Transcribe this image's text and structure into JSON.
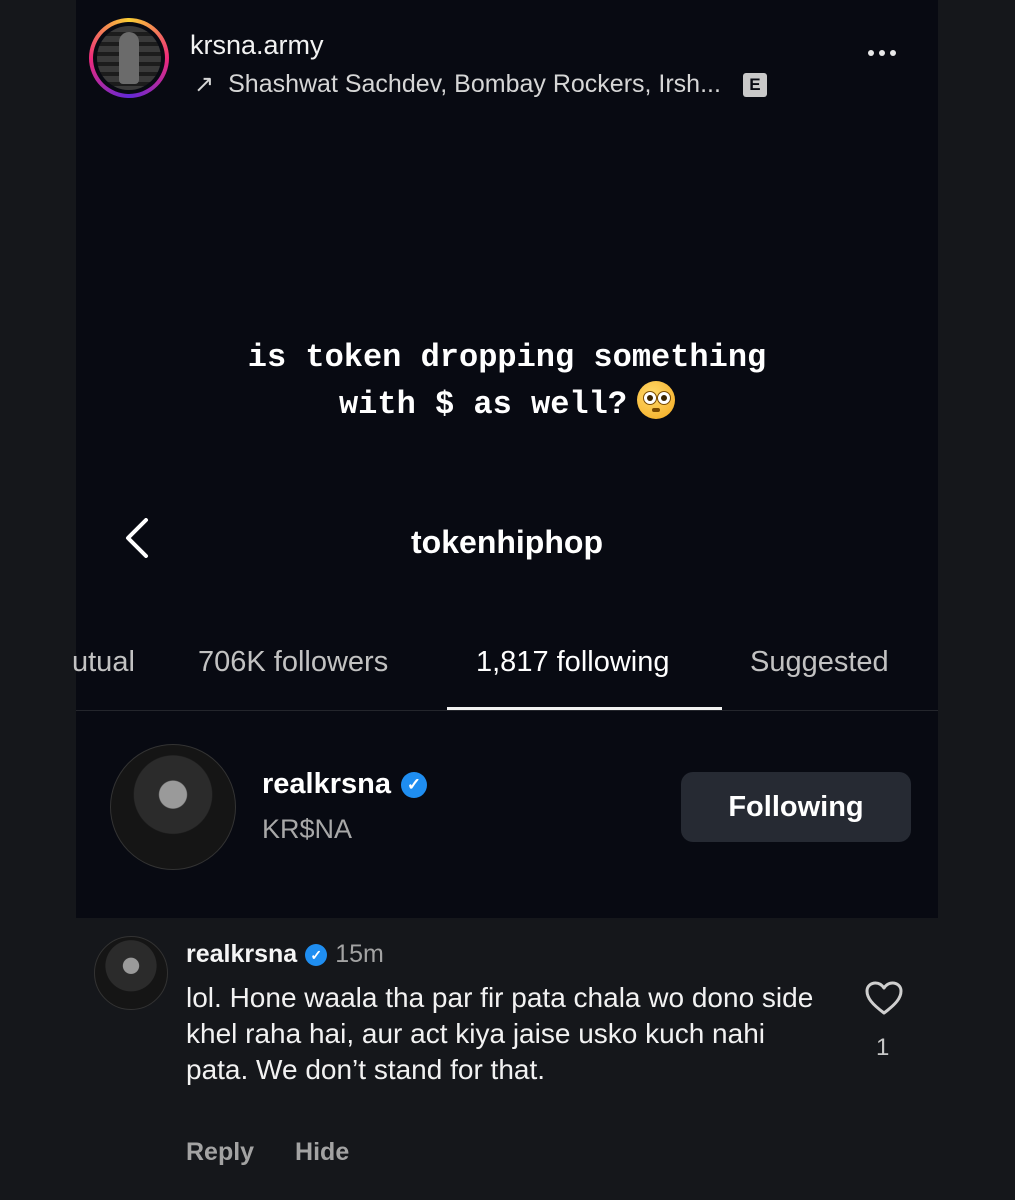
{
  "story": {
    "account_name": "krsna.army",
    "music": "Shashwat Sachdev, Bombay Rockers, Irsh...",
    "explicit_badge": "E",
    "caption_line1": "is token dropping something",
    "caption_line2": "with $ as well?",
    "caption_emoji": "flushed-face-emoji"
  },
  "profile": {
    "handle": "tokenhiphop",
    "tabs": {
      "mutual": "utual",
      "followers": "706K followers",
      "following": "1,817 following",
      "suggested": "Suggested"
    },
    "active_tab": "following",
    "user": {
      "username": "realkrsna",
      "display_name": "KR$NA",
      "verified": true,
      "button_label": "Following"
    }
  },
  "comment": {
    "username": "realkrsna",
    "verified": true,
    "time": "15m",
    "text": "lol. Hone waala tha par fir pata chala wo dono side khel raha hai, aur act kiya jaise usko kuch nahi pata. We don’t stand for that.",
    "reply_label": "Reply",
    "hide_label": "Hide",
    "like_count": "1"
  },
  "colors": {
    "background": "#15171b",
    "story_bg": "#080a12",
    "verified_blue": "#1f8ef1",
    "button_bg": "#262a33"
  }
}
